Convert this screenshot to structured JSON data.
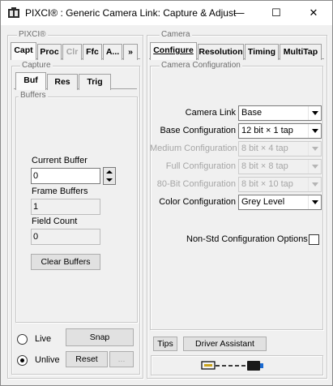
{
  "window": {
    "title": "PIXCI® : Generic Camera Link: Capture & Adjust",
    "minimize_glyph": "—",
    "maximize_glyph": "☐",
    "close_glyph": "✕"
  },
  "left": {
    "group_label": "PIXCI®",
    "tabs": [
      {
        "label": "Capt"
      },
      {
        "label": "Proc"
      },
      {
        "label": "Clr"
      },
      {
        "label": "Ffc"
      },
      {
        "label": "A..."
      },
      {
        "label": "»"
      }
    ],
    "capture_label": "Capture",
    "subtabs": [
      {
        "label": "Buf"
      },
      {
        "label": "Res"
      },
      {
        "label": "Trig"
      }
    ],
    "buffers_label": "Buffers",
    "current_buffer_label": "Current Buffer",
    "current_buffer_value": "0",
    "frame_buffers_label": "Frame Buffers",
    "frame_buffers_value": "1",
    "field_count_label": "Field Count",
    "field_count_value": "0",
    "clear_buffers_label": "Clear Buffers",
    "live_label": "Live",
    "unlive_label": "Unlive",
    "snap_label": "Snap",
    "reset_label": "Reset",
    "small_btn_label": "..."
  },
  "right": {
    "group_label": "Camera",
    "tabs": [
      {
        "label": "Configure"
      },
      {
        "label": "Resolution"
      },
      {
        "label": "Timing"
      },
      {
        "label": "MultiTap"
      }
    ],
    "config_group_label": "Camera Configuration",
    "rows": [
      {
        "label": "Camera Link",
        "value": "Base"
      },
      {
        "label": "Base Configuration",
        "value": "12 bit × 1 tap"
      },
      {
        "label": "Medium Configuration",
        "value": "8 bit × 4 tap"
      },
      {
        "label": "Full Configuration",
        "value": "8 bit × 8 tap"
      },
      {
        "label": "80-Bit Configuration",
        "value": "8 bit × 10 tap"
      },
      {
        "label": "Color Configuration",
        "value": "Grey Level"
      }
    ],
    "nonstd_label": "Non-Std Configuration Options",
    "tips_label": "Tips",
    "driver_assistant_label": "Driver Assistant"
  },
  "icons": {
    "app": "camera-app-icon",
    "status": "camera-link-cable-icon"
  }
}
